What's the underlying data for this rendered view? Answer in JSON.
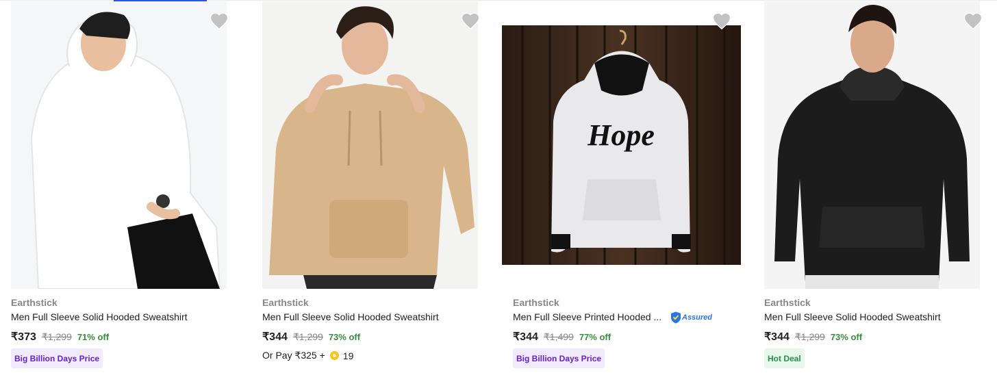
{
  "icons": {
    "wishlist": "heart-icon",
    "assured": "shield-icon",
    "coin": "supercoin-icon"
  },
  "colors": {
    "price_off": "#388e3c",
    "badge_bbd_text": "#6420d5",
    "badge_hot_text": "#25914a",
    "assured_blue": "#2874f0"
  },
  "products": [
    {
      "brand": "Earthstick",
      "title": "Men Full Sleeve Solid Hooded Sweatshirt",
      "price": "₹373",
      "mrp": "₹1,299",
      "discount": "71% off",
      "badge": "Big Billion Days Price"
    },
    {
      "brand": "Earthstick",
      "title": "Men Full Sleeve Solid Hooded Sweatshirt",
      "price": "₹344",
      "mrp": "₹1,299",
      "discount": "73% off",
      "or_pay": "Or Pay ₹325 +",
      "coins": "19"
    },
    {
      "brand": "Earthstick",
      "title": "Men Full Sleeve Printed Hooded ...",
      "assured": "Assured",
      "price": "₹344",
      "mrp": "₹1,499",
      "discount": "77% off",
      "badge": "Big Billion Days Price",
      "print_text": "Hope"
    },
    {
      "brand": "Earthstick",
      "title": "Men Full Sleeve Solid Hooded Sweatshirt",
      "price": "₹344",
      "mrp": "₹1,299",
      "discount": "73% off",
      "badge": "Hot Deal"
    }
  ]
}
